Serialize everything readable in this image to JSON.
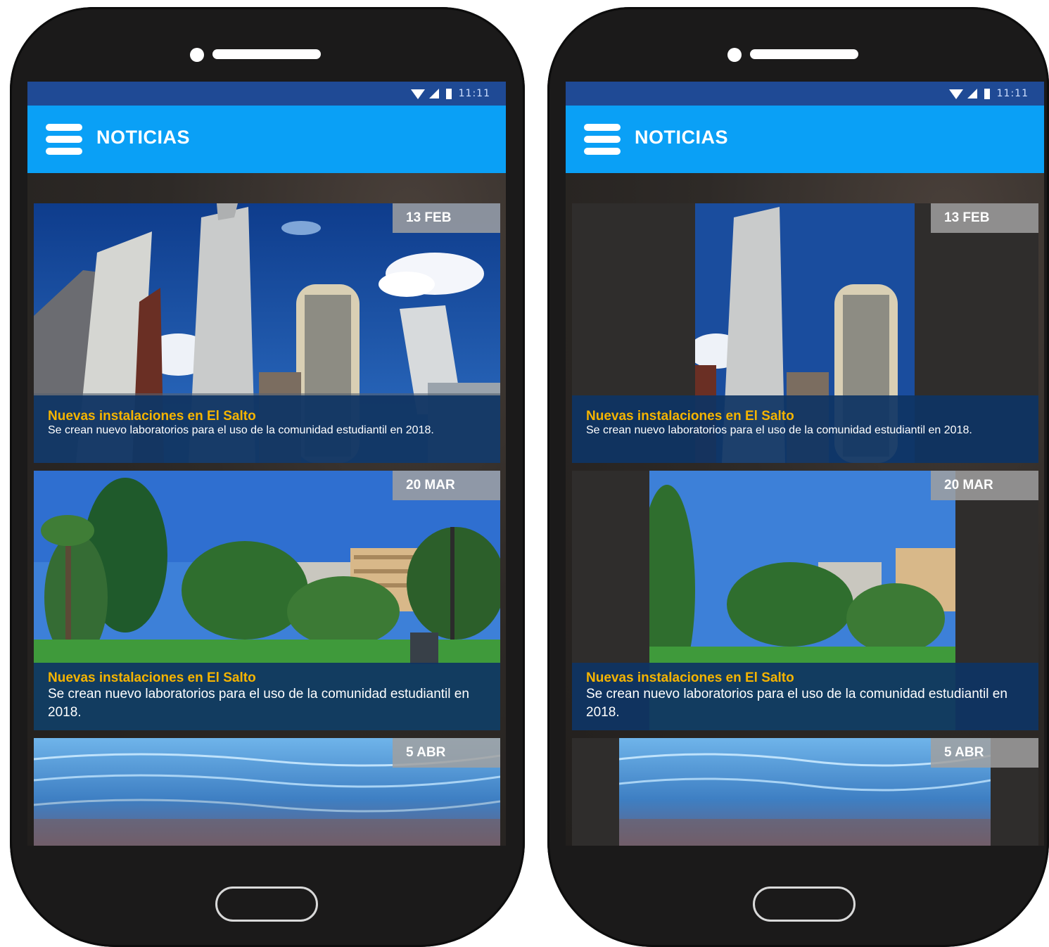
{
  "app": {
    "title": "NOTICIAS"
  },
  "status": {
    "time": "11:11"
  },
  "icons": {
    "menu": "hamburger-menu-icon",
    "wifi": "wifi-icon",
    "signal": "cell-signal-icon",
    "battery": "battery-icon"
  },
  "colors": {
    "status_bar": "#1f4a95",
    "app_bar": "#0aa0f6",
    "caption_bg": "#0e3464",
    "caption_title": "#f5b400",
    "date_badge": "#a0a0a0"
  },
  "news": [
    {
      "date": "13 FEB",
      "title": "Nuevas instalaciones en El Salto",
      "summary": "Se crean nuevo laboratorios para el uso de la comunidad estudiantil en 2018.",
      "image": "city-skyscrapers"
    },
    {
      "date": "20 MAR",
      "title": "Nuevas instalaciones en El Salto",
      "summary": "Se crean nuevo laboratorios para el uso de la comunidad estudiantil en 2018.",
      "image": "campus-park-trees"
    },
    {
      "date": "5 ABR",
      "title": "",
      "summary": "",
      "image": "clear-water-pebbles"
    }
  ]
}
